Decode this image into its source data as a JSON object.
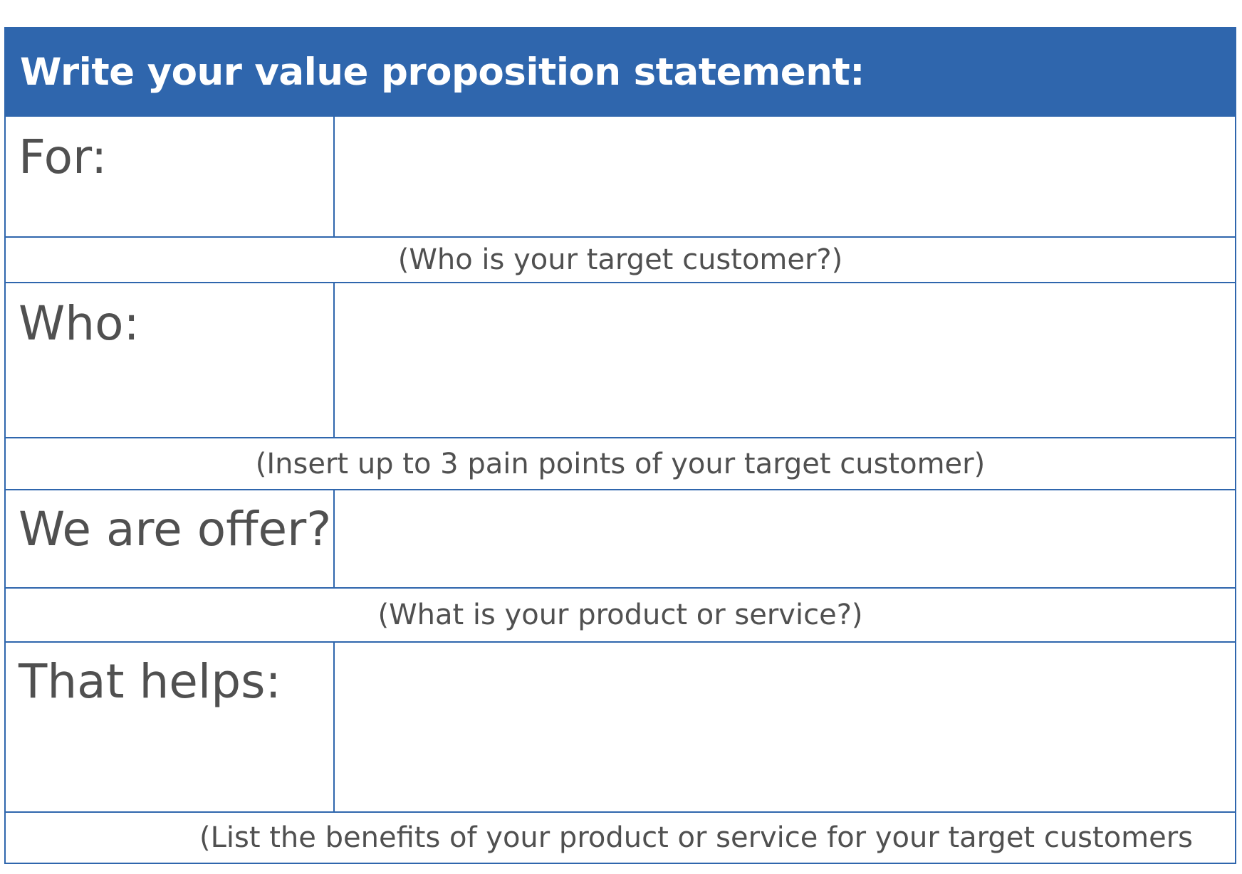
{
  "header": {
    "title": "Write your value proposition statement:"
  },
  "rows": [
    {
      "label": "For:",
      "hint": "(Who is your target customer?)"
    },
    {
      "label": "Who:",
      "hint": "(Insert up to 3 pain points of your target customer)"
    },
    {
      "label": "We are offer?",
      "hint": "(What is your product or service?)"
    },
    {
      "label": "That helps:",
      "hint": "(List the benefits of your product or service for your target customers"
    }
  ],
  "colors": {
    "header_background": "#2f66ad",
    "border": "#2f66ad",
    "header_text": "#ffffff",
    "body_text": "#505050"
  }
}
